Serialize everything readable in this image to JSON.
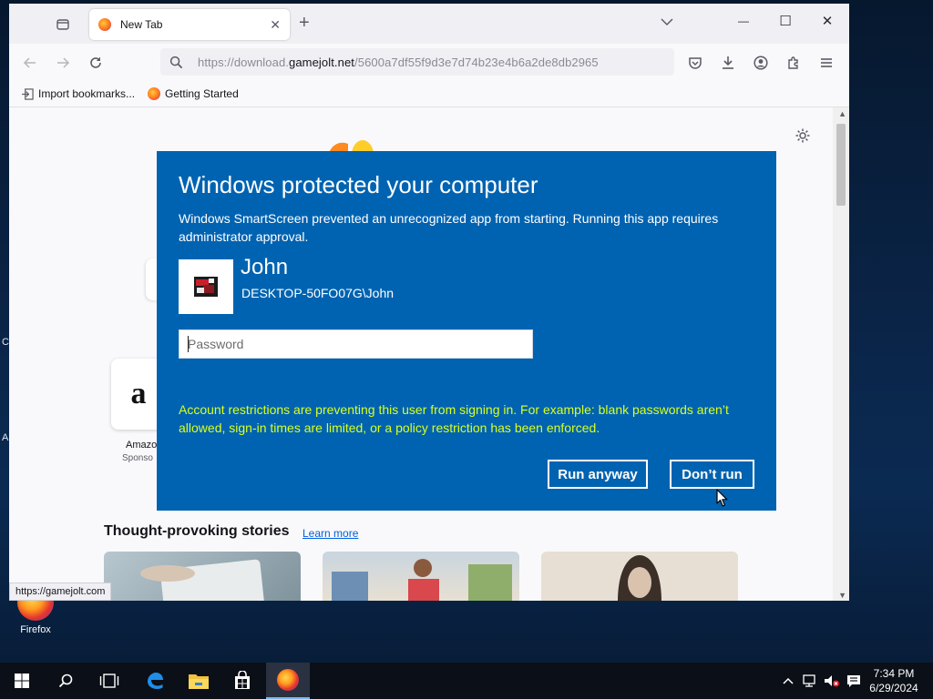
{
  "desktop": {
    "icon_label": "Firefox",
    "stub_letters": [
      "C",
      "A"
    ]
  },
  "browser": {
    "tab": {
      "title": "New Tab",
      "close": "✕"
    },
    "new_tab": "+",
    "window_controls": {
      "minimize": "—",
      "maximize": "☐",
      "close": "✕"
    },
    "url": {
      "prefix": "https://download.",
      "domain": "gamejolt.net",
      "path": "/5600a7df55f9d3e7d74b23e4b6a2de8db2965"
    },
    "bookmarks": [
      {
        "label": "Import bookmarks...",
        "icon": "import-icon"
      },
      {
        "label": "Getting Started",
        "icon": "firefox-icon"
      }
    ],
    "shortcut": {
      "letter": "a",
      "label": "Amazo",
      "sub": "Sponso"
    },
    "stories": {
      "title": "Thought-provoking stories",
      "learn_more": "Learn more"
    },
    "status_url": "https://gamejolt.com"
  },
  "dialog": {
    "title": "Windows protected your computer",
    "description": "Windows SmartScreen prevented an unrecognized app from starting. Running this app requires administrator approval.",
    "user_name": "John",
    "user_domain": "DESKTOP-50FO07G\\John",
    "password_placeholder": "Password",
    "warning": "Account restrictions are preventing this user from signing in. For example: blank passwords aren’t allowed, sign-in times are limited, or a policy restriction has been enforced.",
    "run_anyway": "Run anyway",
    "dont_run": "Don’t run",
    "warning_color": "#d9ff1e",
    "background_color": "#0063b1"
  },
  "taskbar": {
    "time": "7:34 PM",
    "date": "6/29/2024",
    "apps": [
      "start-icon",
      "search-icon",
      "task-view-icon",
      "edge-icon",
      "file-explorer-icon",
      "store-icon",
      "firefox-icon"
    ]
  }
}
